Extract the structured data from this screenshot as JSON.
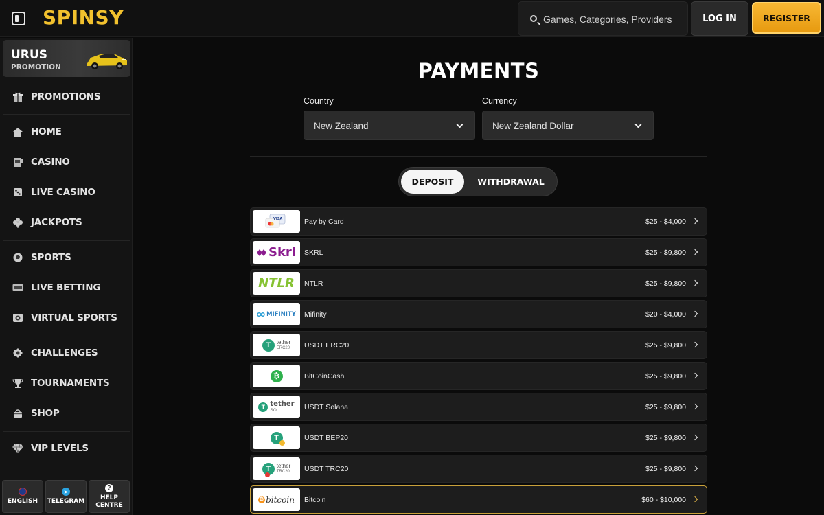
{
  "header": {
    "logo": "SPINSY",
    "search_placeholder": "Games, Categories, Providers",
    "login_label": "LOG IN",
    "register_label": "REGISTER"
  },
  "sidebar": {
    "promo": {
      "title": "URUS",
      "subtitle": "PROMOTION"
    },
    "items": [
      {
        "label": "PROMOTIONS",
        "icon": "gift-icon"
      },
      {
        "label": "HOME",
        "icon": "home-icon"
      },
      {
        "label": "CASINO",
        "icon": "slot-machine-icon"
      },
      {
        "label": "LIVE CASINO",
        "icon": "dice-icon"
      },
      {
        "label": "JACKPOTS",
        "icon": "clover-icon"
      },
      {
        "label": "SPORTS",
        "icon": "ball-icon"
      },
      {
        "label": "LIVE BETTING",
        "icon": "live-icon"
      },
      {
        "label": "VIRTUAL SPORTS",
        "icon": "virtual-icon"
      },
      {
        "label": "CHALLENGES",
        "icon": "badge-icon"
      },
      {
        "label": "TOURNAMENTS",
        "icon": "trophy-icon"
      },
      {
        "label": "SHOP",
        "icon": "bag-icon"
      },
      {
        "label": "VIP LEVELS",
        "icon": "diamond-icon"
      }
    ],
    "bottom": {
      "language": "ENGLISH",
      "telegram": "TELEGRAM",
      "help_line1": "HELP",
      "help_line2": "CENTRE",
      "help_symbol": "?"
    }
  },
  "main": {
    "title": "PAYMENTS",
    "country": {
      "label": "Country",
      "value": "New Zealand"
    },
    "currency": {
      "label": "Currency",
      "value": "New Zealand Dollar"
    },
    "tabs": {
      "deposit": "DEPOSIT",
      "withdrawal": "WITHDRAWAL",
      "active": "deposit"
    },
    "methods": [
      {
        "name": "Pay by Card",
        "range": "$25 - $4,000",
        "logo_text": "VISA"
      },
      {
        "name": "SKRL",
        "range": "$25 - $9,800",
        "logo_text": "Skrl"
      },
      {
        "name": "NTLR",
        "range": "$25 - $9,800",
        "logo_text": "NTLR"
      },
      {
        "name": "Mifinity",
        "range": "$20 - $4,000",
        "logo_text": "MIFINITY"
      },
      {
        "name": "USDT ERC20",
        "range": "$25 - $9,800",
        "logo_text": "tether",
        "logo_sub": "ERC20"
      },
      {
        "name": "BitCoinCash",
        "range": "$25 - $9,800",
        "logo_text": ""
      },
      {
        "name": "USDT Solana",
        "range": "$25 - $9,800",
        "logo_text": "tether",
        "logo_sub": "SOL"
      },
      {
        "name": "USDT BEP20",
        "range": "$25 - $9,800",
        "logo_text": ""
      },
      {
        "name": "USDT TRC20",
        "range": "$25 - $9,800",
        "logo_text": "tether",
        "logo_sub": "TRC20"
      },
      {
        "name": "Bitcoin",
        "range": "$60 - $10,000",
        "logo_text": "bitcoin"
      }
    ]
  },
  "colors": {
    "brand": "#f2c12e",
    "register": "#f0a820",
    "highlight_border": "#c9a13a"
  }
}
